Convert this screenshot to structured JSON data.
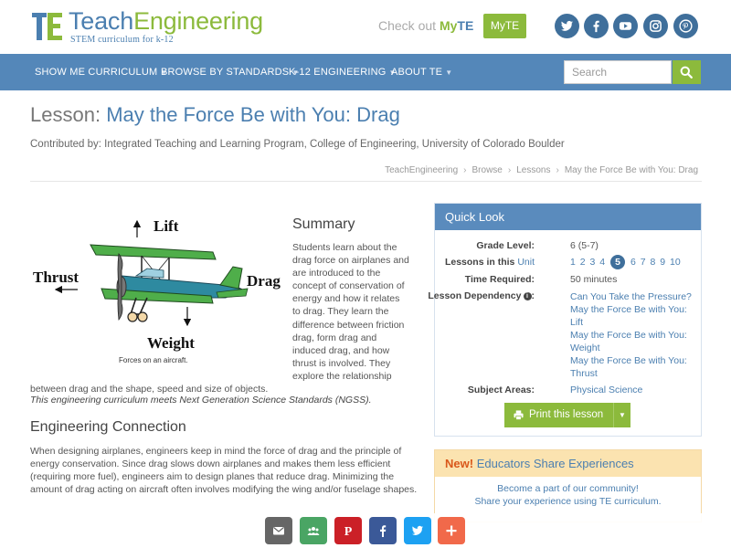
{
  "brand": {
    "name_part1": "Teach",
    "name_part2": "Engineering",
    "tagline": "STEM curriculum for k-12",
    "checkout_prefix": "Check out",
    "checkout_my": "My",
    "checkout_te": "TE",
    "myte_button": "MyTE",
    "colors": {
      "blue": "#4b7fb0",
      "green": "#8cba3c",
      "nav": "#5487b9",
      "social": "#3f6f9b"
    }
  },
  "social_icons": [
    "twitter-icon",
    "facebook-icon",
    "youtube-icon",
    "instagram-icon",
    "pinterest-icon"
  ],
  "nav": {
    "items": [
      {
        "label": "SHOW ME CURRICULUM"
      },
      {
        "label": "BROWSE BY STANDARDS"
      },
      {
        "label": "K-12 ENGINEERING"
      },
      {
        "label": "ABOUT TE"
      }
    ],
    "search_placeholder": "Search"
  },
  "lesson": {
    "prefix": "Lesson:",
    "title": "May the Force Be with You: Drag",
    "contributed": "Contributed by: Integrated Teaching and Learning Program, College of Engineering, University of Colorado Boulder"
  },
  "breadcrumb": [
    "TeachEngineering",
    "Browse",
    "Lessons",
    "May the Force Be with You: Drag"
  ],
  "figure": {
    "labels": {
      "lift": "Lift",
      "thrust": "Thrust",
      "drag": "Drag",
      "weight": "Weight"
    },
    "caption": "Forces on an aircraft."
  },
  "summary": {
    "heading": "Summary",
    "lines": [
      "Students learn about the",
      "drag force on airplanes and",
      "are introduced to the",
      "concept of conservation of",
      "energy and how it relates",
      "to drag. They learn the",
      "difference between friction",
      "drag, form drag and",
      "induced drag, and how",
      "thrust is involved. They",
      "explore the relationship"
    ],
    "last_line": "between drag and the shape, speed and size of objects.",
    "ngss": "This engineering curriculum meets Next Generation Science Standards (NGSS)."
  },
  "engineering": {
    "heading": "Engineering Connection",
    "text": "When designing airplanes, engineers keep in mind the force of drag and the principle of energy conservation. Since drag slows down airplanes and makes them less efficient (requiring more fuel), engineers aim to design planes that reduce drag. Minimizing the amount of drag acting on aircraft often involves modifying the wing and/or fuselage shapes."
  },
  "quick_look": {
    "heading": "Quick Look",
    "grade_label": "Grade Level:",
    "grade_value": "6 (5-7)",
    "lessons_label_prefix": "Lessons in this",
    "lessons_label_link": "Unit",
    "lessons": [
      "1",
      "2",
      "3",
      "4",
      "5",
      "6",
      "7",
      "8",
      "9",
      "10"
    ],
    "current_lesson": "5",
    "time_label": "Time Required:",
    "time_value": "50 minutes",
    "dependency_label": "Lesson Dependency",
    "dependencies": [
      "Can You Take the Pressure?",
      "May the Force Be with You:",
      "Lift",
      "May the Force Be with You:",
      "Weight",
      "May the Force Be with You:",
      "Thrust"
    ],
    "subject_label": "Subject Areas:",
    "subject_value": "Physical Science",
    "print_button": "Print this lesson"
  },
  "educators": {
    "new": "New!",
    "heading": "Educators Share Experiences",
    "line1": "Become a part of our community!",
    "line2": "Share your experience using TE curriculum."
  },
  "share_icons": [
    {
      "name": "email-share-icon",
      "color": "#666666"
    },
    {
      "name": "classroom-share-icon",
      "color": "#4aa564"
    },
    {
      "name": "pinterest-share-icon",
      "color": "#cb2027"
    },
    {
      "name": "facebook-share-icon",
      "color": "#3b5998"
    },
    {
      "name": "twitter-share-icon",
      "color": "#1da1f2"
    },
    {
      "name": "more-share-icon",
      "color": "#f1694a"
    }
  ]
}
